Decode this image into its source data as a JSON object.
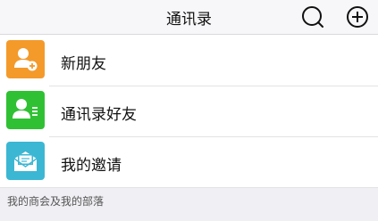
{
  "header": {
    "title": "通讯录",
    "search_icon": "search-icon",
    "add_icon": "add-icon"
  },
  "rows": [
    {
      "label": "新朋友",
      "icon": "add-friend-icon",
      "color": "#f39a2b"
    },
    {
      "label": "通讯录好友",
      "icon": "contacts-list-icon",
      "color": "#2fc133"
    },
    {
      "label": "我的邀请",
      "icon": "invitation-envelope-icon",
      "color": "#3bb7d3"
    }
  ],
  "section": {
    "label": "我的商会及我的部落"
  }
}
